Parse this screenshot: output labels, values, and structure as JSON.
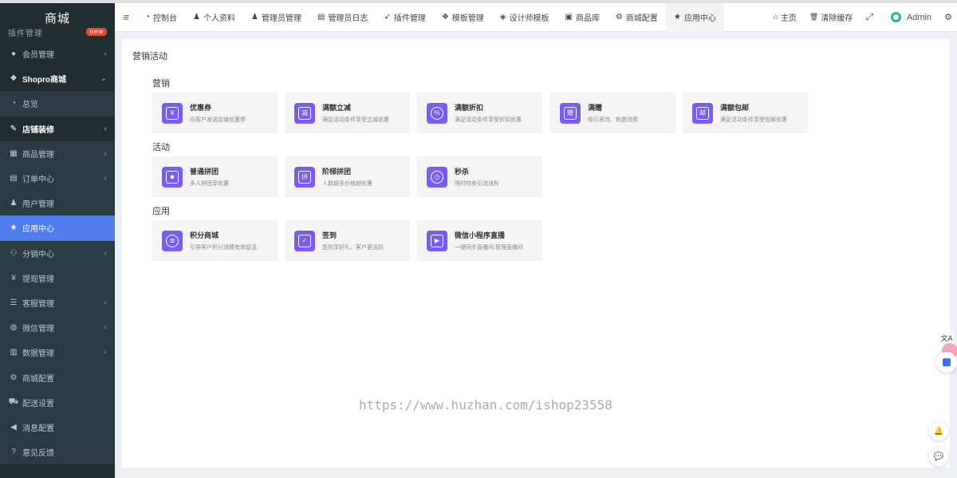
{
  "app": {
    "title": "商城"
  },
  "sidebar": {
    "clipped_item": {
      "label": "插件管理",
      "badge": "new"
    },
    "items": [
      {
        "label": "会员管理",
        "icon": "user-circle-icon",
        "glyph": "●",
        "chevron": "‹"
      },
      {
        "label": "Shopro商城",
        "icon": "dropbox-icon",
        "glyph": "❖",
        "chevron": "⌄"
      },
      {
        "label": "总览",
        "icon": "dashboard-icon",
        "glyph": "◔",
        "chevron": ""
      },
      {
        "label": "店铺装修",
        "icon": "brush-icon",
        "glyph": "✎",
        "chevron": "‹"
      },
      {
        "label": "商品管理",
        "icon": "goods-icon",
        "glyph": "▦",
        "chevron": "‹"
      },
      {
        "label": "订单中心",
        "icon": "file-icon",
        "glyph": "▤",
        "chevron": "‹"
      },
      {
        "label": "用户管理",
        "icon": "user-icon",
        "glyph": "♟",
        "chevron": ""
      },
      {
        "label": "应用中心",
        "icon": "star-icon",
        "glyph": "★",
        "chevron": ""
      },
      {
        "label": "分销中心",
        "icon": "users-icon",
        "glyph": "⚇",
        "chevron": "‹"
      },
      {
        "label": "提现管理",
        "icon": "yen-icon",
        "glyph": "¥",
        "chevron": ""
      },
      {
        "label": "客服管理",
        "icon": "list-icon",
        "glyph": "☰",
        "chevron": "‹"
      },
      {
        "label": "微信管理",
        "icon": "chat-icon",
        "glyph": "◍",
        "chevron": "‹"
      },
      {
        "label": "数据管理",
        "icon": "bar-chart-icon",
        "glyph": "▥",
        "chevron": "‹"
      },
      {
        "label": "商城配置",
        "icon": "cogs-icon",
        "glyph": "⚙",
        "chevron": ""
      },
      {
        "label": "配送设置",
        "icon": "car-icon",
        "glyph": "⛟",
        "chevron": ""
      },
      {
        "label": "消息配置",
        "icon": "bullhorn-icon",
        "glyph": "◀",
        "chevron": ""
      },
      {
        "label": "意见反馈",
        "icon": "question-circle-icon",
        "glyph": "?",
        "chevron": ""
      }
    ]
  },
  "topbar": {
    "menu_glyph": "≡",
    "tabs": [
      {
        "label": "控制台",
        "icon": "dashboard-icon",
        "glyph": "◔"
      },
      {
        "label": "个人资料",
        "icon": "user-icon",
        "glyph": "♟"
      },
      {
        "label": "管理员管理",
        "icon": "user-icon",
        "glyph": "♟"
      },
      {
        "label": "管理员日志",
        "icon": "list-alt-icon",
        "glyph": "▤"
      },
      {
        "label": "插件管理",
        "icon": "rocket-icon",
        "glyph": "➶"
      },
      {
        "label": "模板管理",
        "icon": "cubes-icon",
        "glyph": "❖"
      },
      {
        "label": "设计师模板",
        "icon": "cube-icon",
        "glyph": "◈"
      },
      {
        "label": "商品库",
        "icon": "shopping-bag-icon",
        "glyph": "▣"
      },
      {
        "label": "商城配置",
        "icon": "cogs-icon",
        "glyph": "⚙"
      },
      {
        "label": "应用中心",
        "icon": "star-icon",
        "glyph": "★"
      }
    ],
    "right": {
      "home_label": "主页",
      "home_glyph": "⌂",
      "clear_cache_label": "清除缓存",
      "clear_glyph": "🗑",
      "fullscreen_glyph": "⤢",
      "admin_label": "Admin",
      "settings_glyph": "⚙"
    }
  },
  "main": {
    "panel_title": "营销活动",
    "sections": [
      {
        "title": "营销",
        "cards": [
          {
            "name": "优惠券",
            "desc": "向客户发送店铺优惠券",
            "icon": "coupon-icon",
            "glyph": "¥",
            "shape": "square"
          },
          {
            "name": "满额立减",
            "desc": "满足活动条件享受立减优惠",
            "icon": "discount-minus-icon",
            "glyph": "减",
            "shape": "square"
          },
          {
            "name": "满额折扣",
            "desc": "满足活动条件享受折扣优惠",
            "icon": "percent-icon",
            "glyph": "%",
            "shape": "round"
          },
          {
            "name": "满赠",
            "desc": "吸引客流、刺激消费",
            "icon": "gift-icon",
            "glyph": "赠",
            "shape": "square"
          },
          {
            "name": "满额包邮",
            "desc": "满足活动条件享受包邮优惠",
            "icon": "free-shipping-icon",
            "glyph": "邮",
            "shape": "square"
          }
        ]
      },
      {
        "title": "活动",
        "cards": [
          {
            "name": "普通拼团",
            "desc": "多人拼团享优惠",
            "icon": "group-buy-icon",
            "glyph": "☻",
            "shape": "square"
          },
          {
            "name": "阶梯拼团",
            "desc": "人数越多价格越优惠",
            "icon": "tiered-group-icon",
            "glyph": "拼",
            "shape": "square"
          },
          {
            "name": "秒杀",
            "desc": "限时特卖引流涨粉",
            "icon": "alarm-clock-icon",
            "glyph": "◷",
            "shape": "round"
          }
        ]
      },
      {
        "title": "应用",
        "cards": [
          {
            "name": "积分商城",
            "desc": "引导客户积分消费有效促活",
            "icon": "points-database-icon",
            "glyph": "≣",
            "shape": "round"
          },
          {
            "name": "签到",
            "desc": "签到享好礼、客户更活跃",
            "icon": "sign-in-calendar-icon",
            "glyph": "✓",
            "shape": "square"
          },
          {
            "name": "微信小程序直播",
            "desc": "一键同步直播间,管理直播间",
            "icon": "live-stream-icon",
            "glyph": "▶",
            "shape": "square"
          }
        ]
      }
    ]
  },
  "watermark": "https://www.huzhan.com/ishop23558",
  "floating": {
    "translate_glyph": "文A",
    "notify_glyph": "🔔",
    "chat_glyph": "💬"
  },
  "colors": {
    "sidebar_bg": "#222d32",
    "active_blue": "#4e7cea",
    "card_icon_purple": "#7a5cf0",
    "admin_logo_green": "#18bc9c"
  }
}
